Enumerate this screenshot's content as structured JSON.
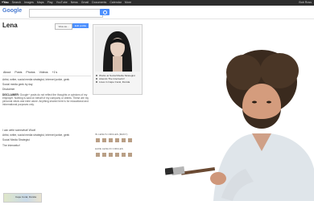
{
  "topbar": {
    "links": [
      "+You",
      "Search",
      "Images",
      "Maps",
      "Play",
      "YouTube",
      "News",
      "Gmail",
      "Documents",
      "Calendar",
      "More"
    ],
    "user": "Bob Ross"
  },
  "search": {
    "logo": "Google",
    "placeholder": ""
  },
  "profile": {
    "name": "Lena",
    "view_as_label": "View as...",
    "edit_label": "Edit profile"
  },
  "tabs": [
    "About",
    "Posts",
    "Photos",
    "Videos",
    "+1's"
  ],
  "intro_lines": [
    "Artist, writer, social media strategist, Internet junkie, geek",
    "Social media geek by day",
    "Disclaimer"
  ],
  "paragraph_label": "DISCLAIMER:",
  "paragraph_body": "Google+ posts do not reflect the thoughts or opinions of my employer. Nothing is said on behalf of my company or clients. These are my personal views and mine alone. Anything shared here is for educational and informational purposes only.",
  "lower_lines": [
    "I can write somewhat! Woot!",
    "Artist, writer, social media strategist, Internet junkie, geek",
    "Social Media Strategist",
    "The Interwebz!",
    "Cape Coral, Florida"
  ],
  "map_caption": "Cape Coral, Florida",
  "info": {
    "works_label": "Works at Social Media Strategist",
    "attended_label": "Attends The Interwebz!",
    "lives_label": "Lives in Cape Coral, Florida"
  },
  "in_circles_label": "IN LENA'S CIRCLES (MANY)",
  "have_in_circles_label": "HAVE LENA IN CIRCLES"
}
